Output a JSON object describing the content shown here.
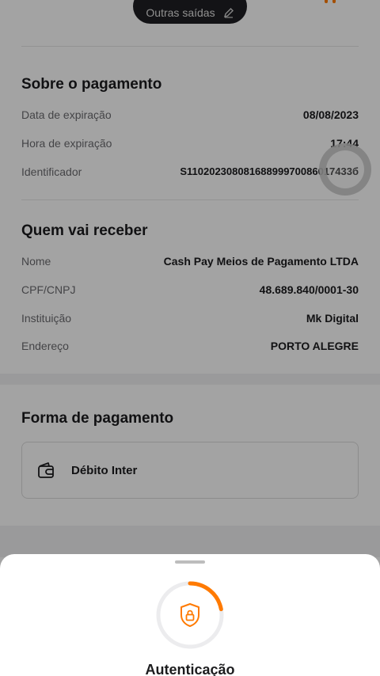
{
  "top_bar": {
    "pill_label": "Outras saídas"
  },
  "payment_info": {
    "title": "Sobre o pagamento",
    "rows": [
      {
        "label": "Data de expiração",
        "value": "08/08/2023"
      },
      {
        "label": "Hora de expiração",
        "value": "17:44"
      },
      {
        "label": "Identificador",
        "value": "S11020230808168899970086017433б"
      }
    ]
  },
  "receiver": {
    "title": "Quem vai receber",
    "rows": [
      {
        "label": "Nome",
        "value": "Cash Pay Meios de Pagamento LTDA"
      },
      {
        "label": "CPF/CNPJ",
        "value": "48.689.840/0001-30"
      },
      {
        "label": "Instituição",
        "value": "Mk Digital"
      },
      {
        "label": "Endereço",
        "value": "PORTO ALEGRE"
      }
    ]
  },
  "payment_method": {
    "title": "Forma de pagamento",
    "option_label": "Débito Inter"
  },
  "auth_sheet": {
    "title": "Autenticação",
    "progress": 0.22
  },
  "colors": {
    "accent": "#ff7a00",
    "text": "#1c1c1e",
    "muted": "#6b6b6f"
  }
}
